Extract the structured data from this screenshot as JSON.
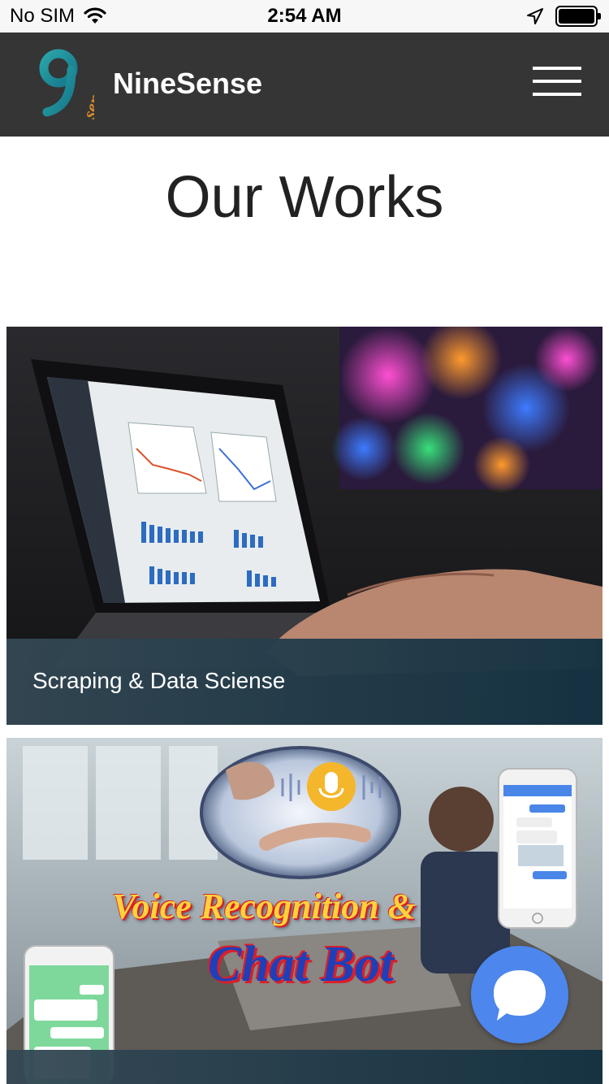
{
  "status_bar": {
    "carrier": "No SIM",
    "time": "2:54 AM",
    "battery_level": 1.0
  },
  "header": {
    "brand": "NineSense",
    "logo_text": "9sense",
    "menu_icon": "hamburger-icon",
    "background_color": "#353535"
  },
  "main": {
    "title": "Our Works",
    "cards": [
      {
        "caption": "Scraping & Data Sciense"
      },
      {
        "caption": "",
        "overlay_text_line1": "Voice Recognition &",
        "overlay_text_line2": "Chat Bot"
      }
    ]
  },
  "chat": {
    "icon": "chat-bubble-icon",
    "color": "#4d86ec"
  }
}
